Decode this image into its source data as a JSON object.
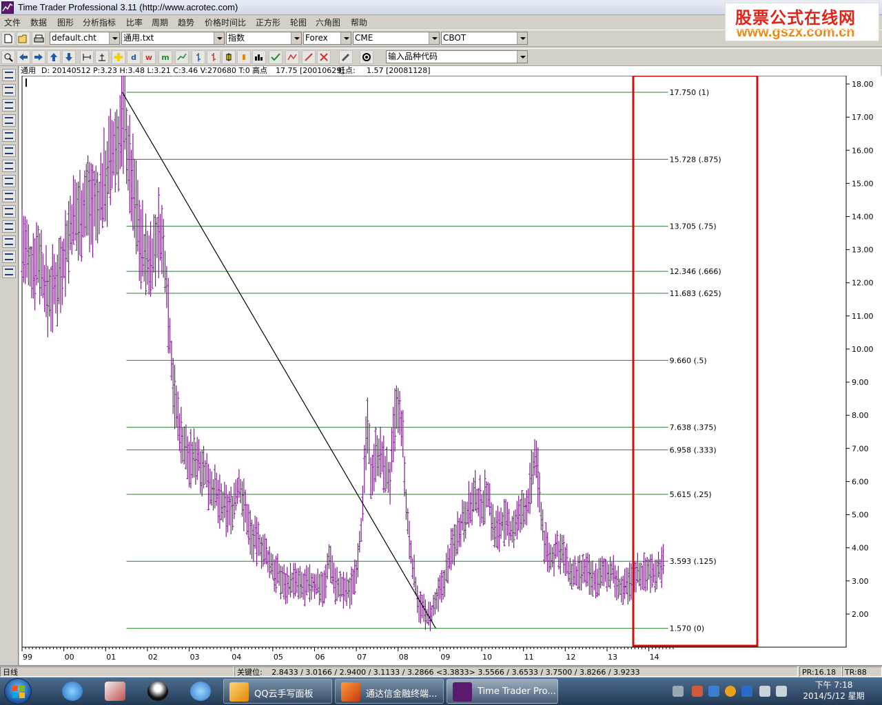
{
  "window": {
    "title": "Time Trader Professional 3.11 (http://www.acrotec.com)"
  },
  "watermark": {
    "line1": "股票公式在线网",
    "line2": "www.gszx.com.cn"
  },
  "menu": [
    "文件",
    "数据",
    "图形",
    "分析指标",
    "比率",
    "周期",
    "趋势",
    "价格时间比",
    "正方形",
    "轮图",
    "六角图",
    "帮助"
  ],
  "toolbar": {
    "combos": [
      "default.cht",
      "通用.txt",
      "指数",
      "Forex",
      "CME",
      "CBOT"
    ],
    "symbol_input": "输入品种代码"
  },
  "info": {
    "symbol": "通用",
    "ohlc": "D: 20140512  P:3.23  H:3.48  L:3.21  C:3.46  V:270680  T:0",
    "high_label": "高点",
    "high_value": "17.75 [20010629]",
    "low_label": "低点:",
    "low_value": "1.57 [20081128]"
  },
  "chart_data": {
    "type": "bar",
    "description_series": "weekly OHLC price bars (purple)",
    "x_ticks": [
      "99",
      "00",
      "01",
      "02",
      "03",
      "04",
      "05",
      "06",
      "07",
      "08",
      "09",
      "10",
      "11",
      "12",
      "13",
      "14"
    ],
    "y_ticks": [
      "2.00",
      "3.00",
      "4.00",
      "5.00",
      "6.00",
      "7.00",
      "8.00",
      "9.00",
      "10.00",
      "11.00",
      "12.00",
      "13.00",
      "14.00",
      "15.00",
      "16.00",
      "17.00",
      "18.00"
    ],
    "ylim": [
      1.0,
      18.25
    ],
    "xlim": [
      1999.0,
      2014.6
    ],
    "price_path": [
      [
        1999.0,
        13.2
      ],
      [
        1999.2,
        12.4
      ],
      [
        1999.4,
        12.9
      ],
      [
        1999.6,
        11.6
      ],
      [
        1999.8,
        11.9
      ],
      [
        2000.0,
        12.8
      ],
      [
        2000.2,
        13.8
      ],
      [
        2000.4,
        14.1
      ],
      [
        2000.6,
        14.6
      ],
      [
        2000.8,
        14.2
      ],
      [
        2001.0,
        15.2
      ],
      [
        2001.2,
        15.9
      ],
      [
        2001.35,
        16.4
      ],
      [
        2001.45,
        17.4
      ],
      [
        2001.55,
        15.6
      ],
      [
        2001.7,
        14.5
      ],
      [
        2001.85,
        13.2
      ],
      [
        2002.0,
        12.6
      ],
      [
        2002.15,
        12.9
      ],
      [
        2002.3,
        13.6
      ],
      [
        2002.45,
        12.2
      ],
      [
        2002.55,
        10.2
      ],
      [
        2002.65,
        8.5
      ],
      [
        2002.8,
        7.4
      ],
      [
        2003.0,
        6.6
      ],
      [
        2003.2,
        6.8
      ],
      [
        2003.4,
        6.2
      ],
      [
        2003.6,
        5.7
      ],
      [
        2003.8,
        5.2
      ],
      [
        2004.0,
        5.1
      ],
      [
        2004.2,
        5.9
      ],
      [
        2004.35,
        5.1
      ],
      [
        2004.5,
        4.3
      ],
      [
        2004.7,
        4.1
      ],
      [
        2004.9,
        3.6
      ],
      [
        2005.1,
        3.2
      ],
      [
        2005.3,
        2.9
      ],
      [
        2005.5,
        3.0
      ],
      [
        2005.7,
        2.8
      ],
      [
        2005.9,
        2.9
      ],
      [
        2006.1,
        2.9
      ],
      [
        2006.25,
        2.8
      ],
      [
        2006.35,
        3.8
      ],
      [
        2006.5,
        2.9
      ],
      [
        2006.7,
        2.7
      ],
      [
        2006.85,
        2.7
      ],
      [
        2007.0,
        3.4
      ],
      [
        2007.15,
        5.0
      ],
      [
        2007.25,
        7.8
      ],
      [
        2007.35,
        6.2
      ],
      [
        2007.5,
        7.0
      ],
      [
        2007.65,
        6.5
      ],
      [
        2007.8,
        6.0
      ],
      [
        2007.95,
        8.2
      ],
      [
        2008.1,
        7.6
      ],
      [
        2008.2,
        5.0
      ],
      [
        2008.35,
        3.4
      ],
      [
        2008.5,
        2.3
      ],
      [
        2008.65,
        2.0
      ],
      [
        2008.75,
        1.85
      ],
      [
        2008.9,
        2.3
      ],
      [
        2009.1,
        3.0
      ],
      [
        2009.25,
        3.8
      ],
      [
        2009.4,
        4.4
      ],
      [
        2009.55,
        4.9
      ],
      [
        2009.7,
        5.2
      ],
      [
        2009.85,
        5.5
      ],
      [
        2010.0,
        5.3
      ],
      [
        2010.15,
        5.7
      ],
      [
        2010.3,
        4.4
      ],
      [
        2010.5,
        4.8
      ],
      [
        2010.7,
        4.5
      ],
      [
        2010.9,
        4.9
      ],
      [
        2011.1,
        5.3
      ],
      [
        2011.2,
        6.1
      ],
      [
        2011.3,
        6.8
      ],
      [
        2011.4,
        5.3
      ],
      [
        2011.5,
        4.2
      ],
      [
        2011.65,
        3.6
      ],
      [
        2011.8,
        4.0
      ],
      [
        2011.95,
        3.8
      ],
      [
        2012.1,
        3.2
      ],
      [
        2012.3,
        3.1
      ],
      [
        2012.5,
        3.3
      ],
      [
        2012.7,
        3.0
      ],
      [
        2012.9,
        3.2
      ],
      [
        2013.1,
        3.3
      ],
      [
        2013.25,
        2.9
      ],
      [
        2013.4,
        2.7
      ],
      [
        2013.55,
        3.0
      ],
      [
        2013.7,
        3.3
      ],
      [
        2013.85,
        3.2
      ],
      [
        2014.0,
        3.3
      ],
      [
        2014.15,
        3.3
      ],
      [
        2014.35,
        3.46
      ]
    ],
    "trend_line": {
      "from": [
        2001.4,
        17.75
      ],
      "to": [
        2008.9,
        1.57
      ]
    },
    "fib_levels": [
      {
        "price": 17.75,
        "label": "17.750  (1)"
      },
      {
        "price": 15.728,
        "label": "15.728  (.875)"
      },
      {
        "price": 13.705,
        "label": "13.705  (.75)"
      },
      {
        "price": 12.346,
        "label": "12.346  (.666)"
      },
      {
        "price": 11.683,
        "label": "11.683  (.625)"
      },
      {
        "price": 9.66,
        "label": "9.660  (.5)"
      },
      {
        "price": 7.638,
        "label": "7.638  (.375)"
      },
      {
        "price": 6.958,
        "label": "6.958  (.333)"
      },
      {
        "price": 5.615,
        "label": "5.615  (.25)"
      },
      {
        "price": 3.593,
        "label": "3.593  (.125)"
      },
      {
        "price": 1.57,
        "label": "1.570  (0)"
      }
    ],
    "colors": {
      "bars": "#7a1f8a",
      "fib": "#2e7d32",
      "trend": "#000000",
      "highlight": "#cc1111"
    }
  },
  "status": {
    "period": "日线",
    "key_label": "关键位:",
    "key_values": "2.8433 / 3.0166 / 2.9400 / 3.1133 / 3.2866 <3.3833> 3.5566 / 3.6533 / 3.7500 / 3.8266 / 3.9233",
    "pr": "PR:16.18",
    "tr": "TR:88"
  },
  "taskbar": {
    "tasks": [
      "QQ云手写面板",
      "通达信金融终端...",
      "Time Trader Pro..."
    ],
    "time": "下午 7:18",
    "date": "2014/5/12 星期一"
  }
}
